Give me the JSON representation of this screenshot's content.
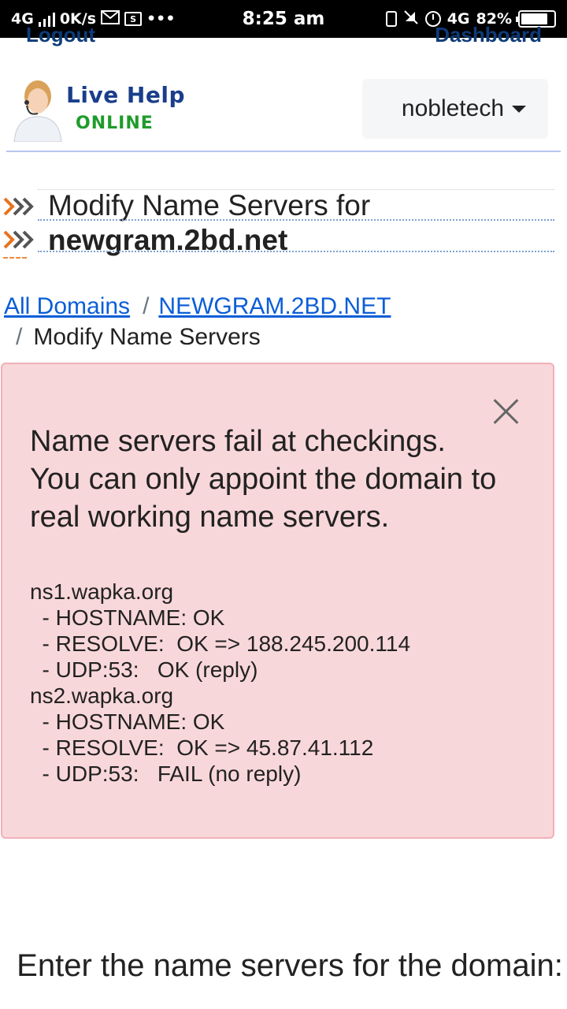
{
  "status_bar": {
    "network": "4G",
    "speed": "0K/s",
    "time": "8:25 am",
    "network_right": "4G",
    "battery": "82%",
    "battery_level": 0.82
  },
  "top_links": {
    "logout": "Logout",
    "dashboard": "Dashboard"
  },
  "logo": {
    "line1": "Live Help",
    "line2": "ONLINE"
  },
  "user_menu": {
    "username": "nobletech"
  },
  "page_title": {
    "line1": "Modify Name Servers for",
    "domain": "newgram.2bd.net"
  },
  "breadcrumb": {
    "items": [
      "All Domains",
      "NEWGRAM.2BD.NET"
    ],
    "separator": "/",
    "current": "Modify Name Servers"
  },
  "alert": {
    "message": "Name servers fail at checkings. You can only appoint the domain to real working name servers.",
    "details": "ns1.wapka.org\n  - HOSTNAME: OK\n  - RESOLVE:  OK => 188.245.200.114\n  - UDP:53:   OK (reply)\nns2.wapka.org\n  - HOSTNAME: OK\n  - RESOLVE:  OK => 45.87.41.112\n  - UDP:53:   FAIL (no reply)"
  },
  "form": {
    "heading": "Enter the name servers for the domain:"
  }
}
